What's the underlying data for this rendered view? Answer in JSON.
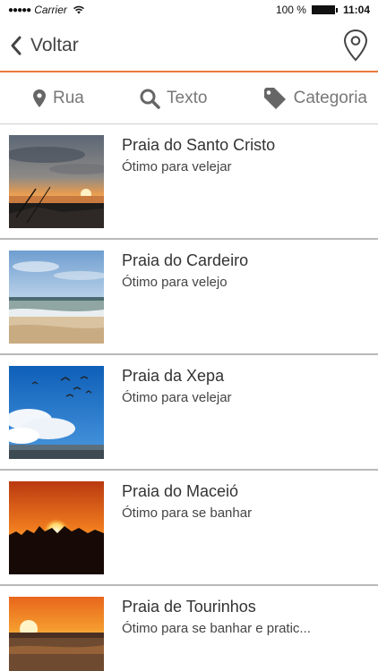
{
  "status_bar": {
    "carrier": "Carrier",
    "battery_percent": "100 %",
    "time": "11:04"
  },
  "nav": {
    "back_label": "Voltar",
    "icons": {
      "back": "chevron-left-icon",
      "location": "map-pin-icon"
    }
  },
  "filters": [
    {
      "label": "Rua",
      "icon": "map-pin-icon"
    },
    {
      "label": "Texto",
      "icon": "search-icon"
    },
    {
      "label": "Categoria",
      "icon": "tag-icon"
    }
  ],
  "colors": {
    "accent": "#e8793a",
    "divider": "#b9b9b9",
    "filter_text": "#777777"
  },
  "beaches": [
    {
      "title": "Praia do Santo Cristo",
      "description": "Ótimo para velejar",
      "image": "sunset-over-beach"
    },
    {
      "title": "Praia do Cardeiro",
      "description": "Ótimo para velejo",
      "image": "beach-shoreline"
    },
    {
      "title": "Praia da Xepa",
      "description": "Ótimo para velejar",
      "image": "kites-blue-sky"
    },
    {
      "title": "Praia do Maceió",
      "description": "Ótimo para se banhar",
      "image": "orange-sunset"
    },
    {
      "title": "Praia de Tourinhos",
      "description": "Ótimo para se banhar e pratic...",
      "image": "sunset-horizon"
    }
  ]
}
